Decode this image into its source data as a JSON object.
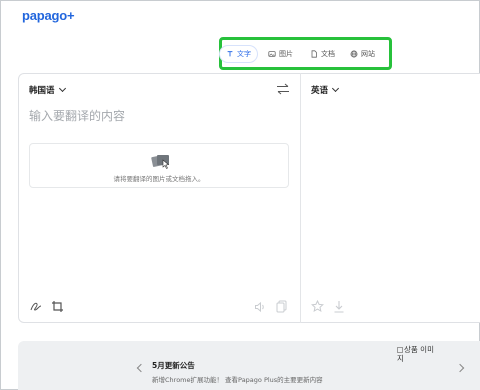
{
  "app": {
    "logo": "papago+"
  },
  "tabs": [
    {
      "label": "文字",
      "icon": "text-icon",
      "active": true
    },
    {
      "label": "图片",
      "icon": "image-icon",
      "active": false
    },
    {
      "label": "文档",
      "icon": "document-icon",
      "active": false
    },
    {
      "label": "网站",
      "icon": "globe-icon",
      "active": false
    }
  ],
  "source": {
    "language": "韩国语",
    "placeholder": "输入要翻译的内容",
    "drop_hint": "请将要翻译的图片或文档拖入。"
  },
  "target": {
    "language": "英语"
  },
  "banner": {
    "title": "5月更新公告",
    "subtitle": "新增Chrome扩展功能！ 查看Papago Plus的主要更新内容",
    "image_alt": "상품 이미지"
  },
  "colors": {
    "brand": "#2266dd",
    "active_tab": "#2f6ee8",
    "highlight": "#27c13b"
  }
}
